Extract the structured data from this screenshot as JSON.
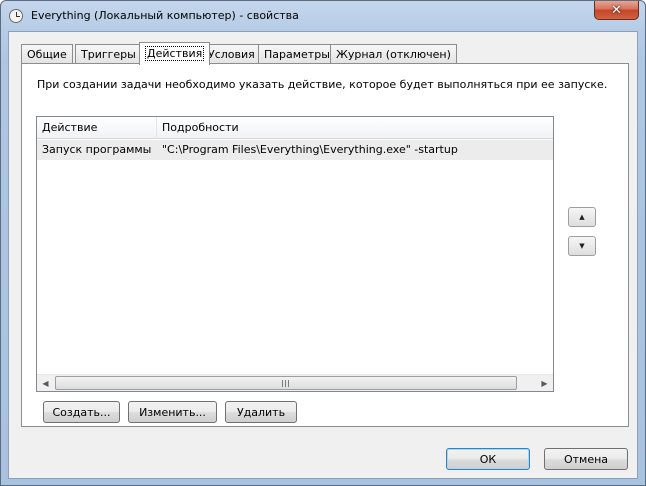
{
  "window": {
    "title": "Everything (Локальный компьютер) - свойства",
    "close_glyph": "✕",
    "icon": "task-scheduler-clock-icon"
  },
  "tabs": [
    {
      "label": "Общие",
      "active": false
    },
    {
      "label": "Триггеры",
      "active": false
    },
    {
      "label": "Действия",
      "active": true
    },
    {
      "label": "Условия",
      "active": false
    },
    {
      "label": "Параметры",
      "active": false
    },
    {
      "label": "Журнал (отключен)",
      "active": false
    }
  ],
  "actions_tab": {
    "description": "При создании задачи необходимо указать действие, которое будет выполняться при ее запуске.",
    "columns": [
      "Действие",
      "Подробности"
    ],
    "rows": [
      {
        "action": "Запуск программы",
        "details": "\"C:\\Program Files\\Everything\\Everything.exe\" -startup"
      }
    ],
    "move_up_glyph": "▲",
    "move_down_glyph": "▼",
    "scroll_left_glyph": "◀",
    "scroll_right_glyph": "▶",
    "buttons": {
      "create": "Создать...",
      "edit": "Изменить...",
      "delete": "Удалить"
    }
  },
  "dialog_buttons": {
    "ok": "ОК",
    "cancel": "Отмена"
  },
  "colors": {
    "selected_row": "#ececec",
    "frame": "#aec6e2",
    "close": "#c4462b"
  }
}
